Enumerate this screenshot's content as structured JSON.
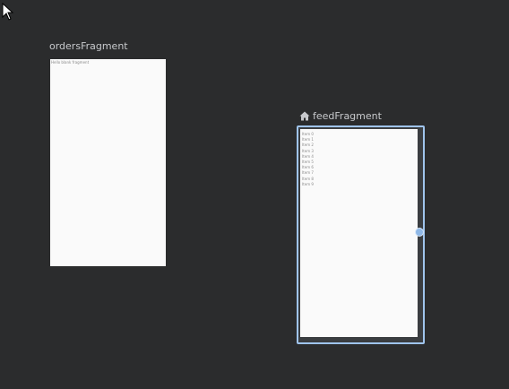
{
  "cursor": {
    "icon": "arrow-cursor-icon"
  },
  "orders_fragment": {
    "title": "ordersFragment",
    "content_text": "Hello blank fragment"
  },
  "feed_fragment": {
    "title": "feedFragment",
    "home_icon": "home-icon",
    "selected": true,
    "items": [
      "Item 0",
      "Item 1",
      "Item 2",
      "Item 3",
      "Item 4",
      "Item 5",
      "Item 6",
      "Item 7",
      "Item 8",
      "Item 9"
    ]
  },
  "colors": {
    "canvas_background": "#2b2c2d",
    "selection_border": "#9fc4ec",
    "handle_fill": "#8fb8e6",
    "screen_background": "#fafafa",
    "title_text": "#c7c9cc"
  }
}
